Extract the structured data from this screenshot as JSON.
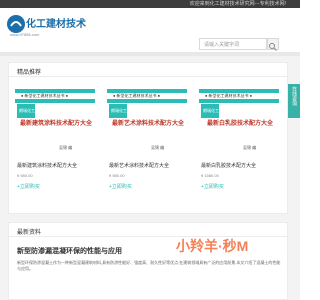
{
  "topbar": {
    "text": "欢迎来到化工建材技术研究网---专利技术网!"
  },
  "header": {
    "logo_text": "化工建材技术",
    "logo_url": "www.97886.com",
    "search_placeholder": "请输入关键字词"
  },
  "section1": {
    "title": "精品推荐"
  },
  "side_tab": {
    "label": "在线咨询"
  },
  "cards": [
    {
      "strip": "● 新型化工建材技术丛书 ●",
      "badge": "朗瑞化工",
      "cover_title": "最新建筑涂料技术配方大全",
      "author": "吴锦 编",
      "name": "最新建筑涂料技术配方大全",
      "price": "¥ 980.00",
      "buy": "+立即购买"
    },
    {
      "strip": "● 新型化工建材技术丛书 ●",
      "badge": "朗瑞化工",
      "cover_title": "最新艺术涂料技术配方大全",
      "author": "吴锦 编",
      "name": "最新艺术涂料技术配方大全",
      "price": "¥ 980.00",
      "buy": "+立即购买"
    },
    {
      "strip": "● 新型化工建材技术丛书 ●",
      "badge": "朗瑞化工",
      "cover_title": "最新白乳胶技术配方大全",
      "author": "吴锦 编",
      "name": "最新白乳胶技术配方大全",
      "price": "¥ 1580.00",
      "buy": "+立即购买"
    }
  ],
  "section2": {
    "title": "最新资料"
  },
  "article": {
    "title": "新型防渗漏混凝环保的性能与应用",
    "text": "新型环保防渗混凝土作为一种新型混凝建筑材料,具有防渗性能好、强度高、耐久性好等优点,在建筑领域具有广泛的应用前景,本文介绍了混凝土的性能与应用。"
  },
  "watermark": {
    "text": "小羚羊·秒M"
  },
  "colors": {
    "accent": "#2bbcb5",
    "cover_title": "#c0392b",
    "topbar": "#3d3d3d"
  }
}
